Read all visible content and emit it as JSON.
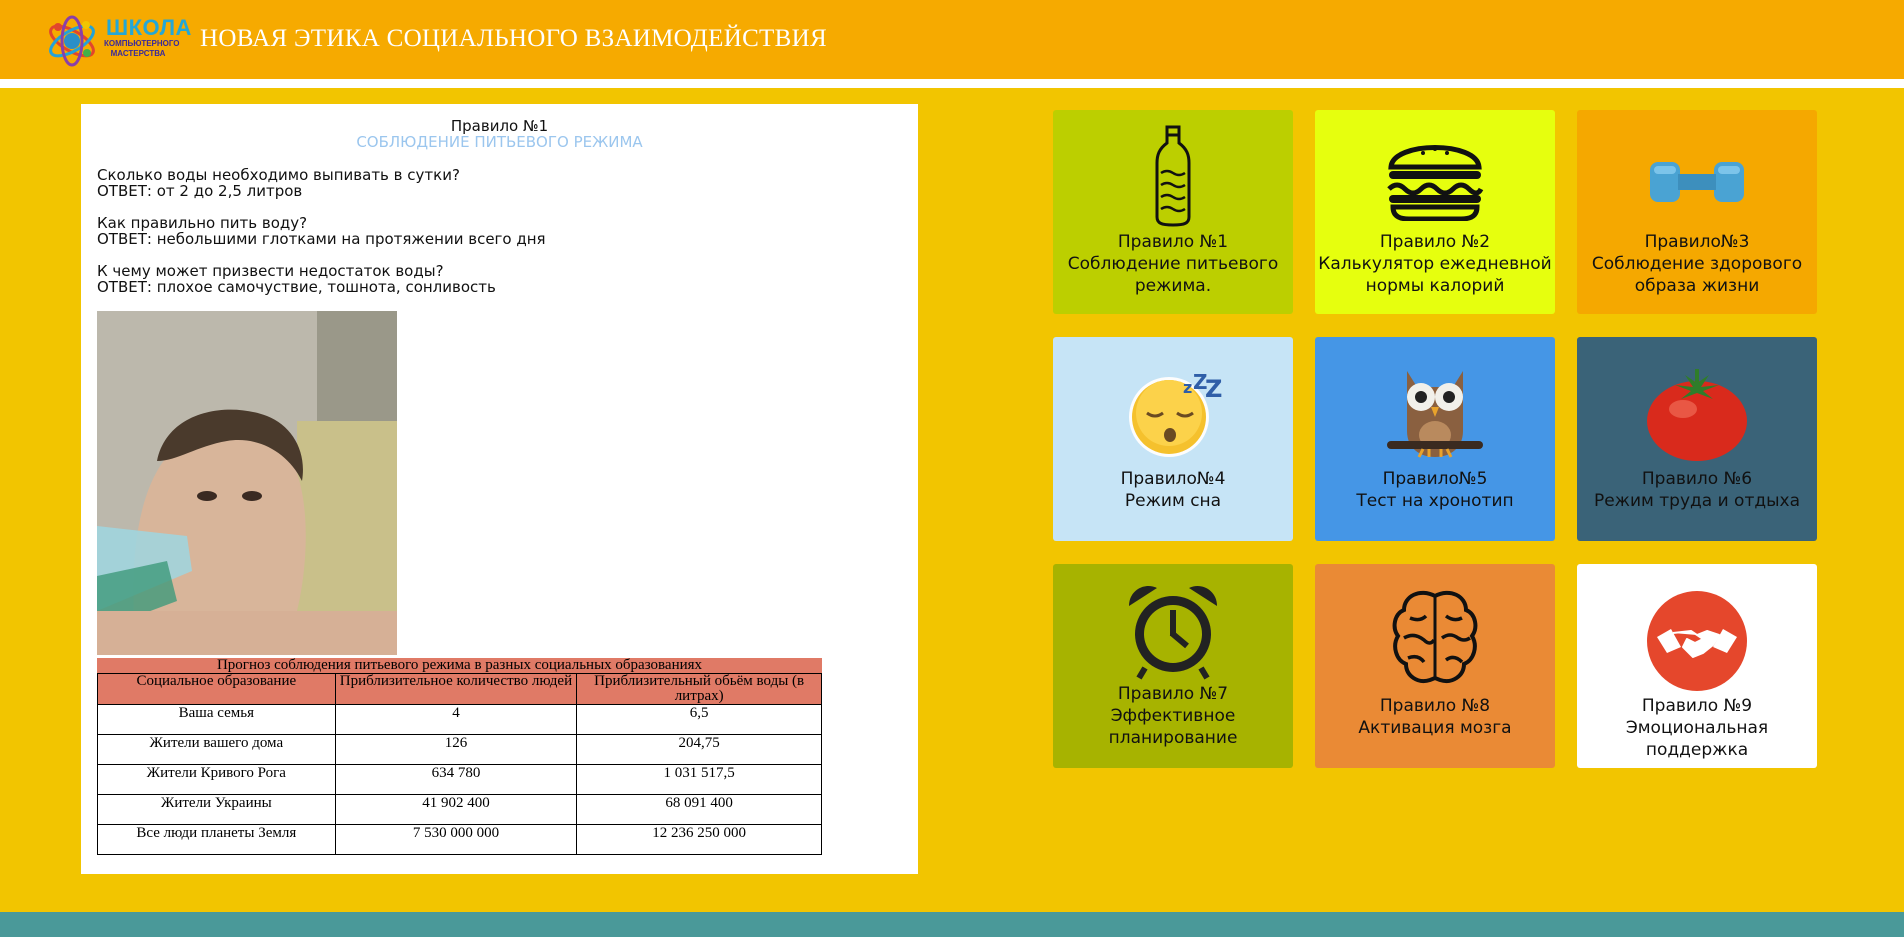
{
  "header": {
    "logo_line1": "ШКОЛА",
    "logo_line2": "КОМПЬЮТЕРНОГО МАСТЕРСТВА",
    "title": "НОВАЯ ЭТИКА СОЦИАЛЬНОГО ВЗАИМОДЕЙСТВИЯ"
  },
  "article": {
    "rule_title": "Правило №1",
    "rule_subtitle": "СОБЛЮДЕНИЕ ПИТЬЕВОГО РЕЖИМА",
    "qa": [
      {
        "q": "Сколько воды необходимо выпивать в сутки?",
        "a": "ОТВЕТ: от 2 до 2,5 литров"
      },
      {
        "q": "Как правильно пить воду?",
        "a": "ОТВЕТ: небольшими глотками на протяжении всего дня"
      },
      {
        "q": "К чему может призвести недостаток воды?",
        "a": "ОТВЕТ: плохое самочуствие, тошнота, сонливость"
      }
    ],
    "table_caption": "Прогноз соблюдения питьевого режима в разных социальных образованиях",
    "table_headers": [
      "Социальное образование",
      "Приблизительное количество людей",
      "Приблизительный обьём воды (в литрах)"
    ],
    "table_rows": [
      [
        "Ваша семья",
        "4",
        "6,5"
      ],
      [
        "Жители вашего дома",
        "126",
        "204,75"
      ],
      [
        "Жители Кривого Рога",
        "634 780",
        "1 031 517,5"
      ],
      [
        "Жители Украины",
        "41 902 400",
        "68 091 400"
      ],
      [
        "Все люди планеты Земля",
        "7 530 000 000",
        "12 236 250 000"
      ]
    ]
  },
  "tiles": [
    {
      "line1": "Правило №1",
      "line2": "Соблюдение питьевого",
      "line3": "режима.",
      "bg": "#bccf00",
      "icon": "water-bottle-icon"
    },
    {
      "line1": "Правило №2",
      "line2": "Калькулятор ежедневной",
      "line3": "нормы калорий",
      "bg": "#e6ff0e",
      "icon": "burger-icon"
    },
    {
      "line1": "Правило№3",
      "line2": "Соблюдение здорового",
      "line3": "образа жизни",
      "bg": "#f5a800",
      "icon": "dumbbell-icon"
    },
    {
      "line1": "Правило№4",
      "line2": "Режим сна",
      "line3": "",
      "bg": "#c6e4f6",
      "icon": "sleeping-face-icon"
    },
    {
      "line1": "Правило№5",
      "line2": "Тест на хронотип",
      "line3": "",
      "bg": "#4596e6",
      "icon": "owl-icon"
    },
    {
      "line1": "Правило №6",
      "line2": "Режим труда и отдыха",
      "line3": "",
      "bg": "#3a6378",
      "icon": "tomato-icon"
    },
    {
      "line1": "Правило №7",
      "line2": "Эффективное",
      "line3": "планирование",
      "bg": "#a7b300",
      "icon": "alarm-clock-icon"
    },
    {
      "line1": "Правило №8",
      "line2": "Активация мозга",
      "line3": "",
      "bg": "#ea8a35",
      "icon": "brain-icon"
    },
    {
      "line1": "Правило №9",
      "line2": "Эмоциональная поддержка",
      "line3": "",
      "bg": "#ffffff",
      "icon": "handshake-icon"
    }
  ]
}
